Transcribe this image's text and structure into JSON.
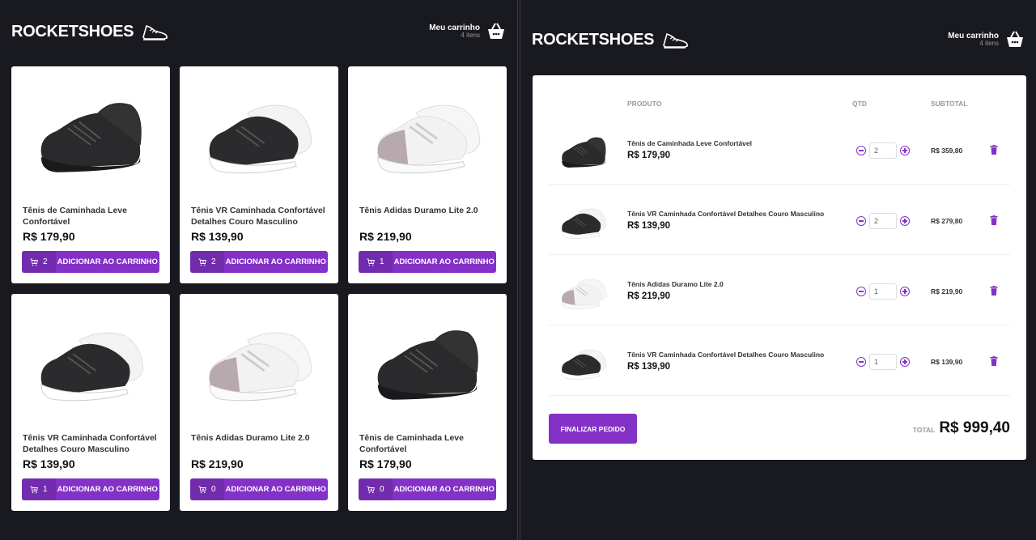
{
  "brand": "ROCKETSHOES",
  "cart": {
    "title": "Meu carrinho",
    "count": "4 itens"
  },
  "products": [
    {
      "title": "Tênis de Caminhada Leve Confortável",
      "price": "R$ 179,90",
      "amount": "2",
      "button": "ADICIONAR AO CARRINHO",
      "shoe": "black"
    },
    {
      "title": "Tênis VR Caminhada Confortável Detalhes Couro Masculino",
      "price": "R$ 139,90",
      "amount": "2",
      "button": "ADICIONAR AO CARRINHO",
      "shoe": "black-white"
    },
    {
      "title": "Tênis Adidas Duramo Lite 2.0",
      "price": "R$ 219,90",
      "amount": "1",
      "button": "ADICIONAR AO CARRINHO",
      "shoe": "white-grey"
    },
    {
      "title": "Tênis VR Caminhada Confortável Detalhes Couro Masculino",
      "price": "R$ 139,90",
      "amount": "1",
      "button": "ADICIONAR AO CARRINHO",
      "shoe": "black-white"
    },
    {
      "title": "Tênis Adidas Duramo Lite 2.0",
      "price": "R$ 219,90",
      "amount": "0",
      "button": "ADICIONAR AO CARRINHO",
      "shoe": "white-grey"
    },
    {
      "title": "Tênis de Caminhada Leve Confortável",
      "price": "R$ 179,90",
      "amount": "0",
      "button": "ADICIONAR AO CARRINHO",
      "shoe": "black"
    }
  ],
  "cart_table": {
    "headers": {
      "product": "PRODUTO",
      "qty": "QTD",
      "subtotal": "SUBTOTAL"
    },
    "items": [
      {
        "title": "Tênis de Caminhada Leve Confortável",
        "price": "R$ 179,90",
        "qty": "2",
        "subtotal": "R$ 359,80",
        "shoe": "black"
      },
      {
        "title": "Tênis VR Caminhada Confortável Detalhes Couro Masculino",
        "price": "R$ 139,90",
        "qty": "2",
        "subtotal": "R$ 279,80",
        "shoe": "black-white"
      },
      {
        "title": "Tênis Adidas Duramo Lite 2.0",
        "price": "R$ 219,90",
        "qty": "1",
        "subtotal": "R$ 219,90",
        "shoe": "white-grey"
      },
      {
        "title": "Tênis VR Caminhada Confortável Detalhes Couro Masculino",
        "price": "R$ 139,90",
        "qty": "1",
        "subtotal": "R$ 139,90",
        "shoe": "black-white"
      }
    ],
    "finish_button": "FINALIZAR PEDIDO",
    "total_label": "TOTAL",
    "total_value": "R$ 999,40"
  },
  "colors": {
    "background": "#191920",
    "accent": "#8331c6",
    "card": "#ffffff"
  },
  "icons": [
    "shoe-logo-icon",
    "basket-icon",
    "cart-add-icon",
    "minus-circle-icon",
    "plus-circle-icon",
    "trash-icon"
  ]
}
